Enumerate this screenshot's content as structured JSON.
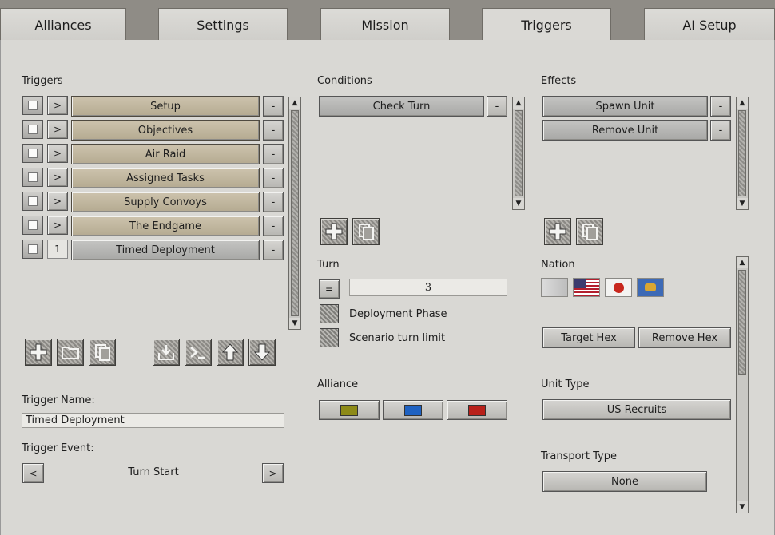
{
  "tabs": [
    {
      "label": "Alliances",
      "active": false
    },
    {
      "label": "Settings",
      "active": false
    },
    {
      "label": "Mission",
      "active": false
    },
    {
      "label": "Triggers",
      "active": true
    },
    {
      "label": "AI Setup",
      "active": false
    }
  ],
  "triggers": {
    "heading": "Triggers",
    "items": [
      {
        "expand": ">",
        "label": "Setup",
        "remove": "-"
      },
      {
        "expand": ">",
        "label": "Objectives",
        "remove": "-"
      },
      {
        "expand": ">",
        "label": "Air Raid",
        "remove": "-"
      },
      {
        "expand": ">",
        "label": "Assigned Tasks",
        "remove": "-"
      },
      {
        "expand": ">",
        "label": "Supply Convoys",
        "remove": "-"
      },
      {
        "expand": ">",
        "label": "The Endgame",
        "remove": "-"
      },
      {
        "expand": "1",
        "label": "Timed Deployment",
        "remove": "-"
      }
    ],
    "name_label": "Trigger Name:",
    "name_value": "Timed Deployment",
    "event_label": "Trigger Event:",
    "event_prev": "<",
    "event_value": "Turn Start",
    "event_next": ">"
  },
  "conditions": {
    "heading": "Conditions",
    "items": [
      {
        "label": "Check Turn",
        "remove": "-"
      }
    ],
    "turn_label": "Turn",
    "turn_operator": "=",
    "turn_value": "3",
    "deployment_phase": "Deployment Phase",
    "scenario_limit": "Scenario turn limit",
    "alliance_label": "Alliance",
    "alliance_colors": [
      "#8d8a17",
      "#1f62c2",
      "#b8201a"
    ]
  },
  "effects": {
    "heading": "Effects",
    "items": [
      {
        "label": "Spawn Unit",
        "remove": "-"
      },
      {
        "label": "Remove Unit",
        "remove": "-"
      }
    ],
    "nation_label": "Nation",
    "target_hex": "Target Hex",
    "remove_hex": "Remove Hex",
    "unit_type_label": "Unit Type",
    "unit_type_value": "US Recruits",
    "transport_type_label": "Transport Type",
    "transport_type_value": "None"
  }
}
